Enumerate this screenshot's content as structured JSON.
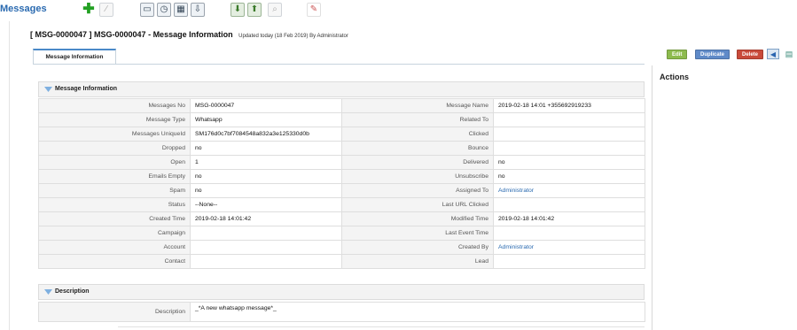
{
  "module_title": "Messages",
  "toolbar": {
    "buttons": [
      {
        "icon": "plus-icon"
      },
      {
        "icon": "blank-icon"
      },
      {
        "icon": "calendar-icon"
      },
      {
        "icon": "clock-icon"
      },
      {
        "icon": "calculator-icon"
      },
      {
        "icon": "import-icon"
      },
      {
        "icon": "download-icon"
      },
      {
        "icon": "upload-icon"
      },
      {
        "icon": "find-duplicates-icon"
      },
      {
        "icon": "settings-wrench-icon"
      }
    ]
  },
  "record": {
    "title": "[ MSG-0000047 ] MSG-0000047 - Message Information",
    "updated": "Updated today (18 Feb 2019) By Administrator"
  },
  "tab": {
    "label": "Message Information"
  },
  "actions": {
    "title": "Actions",
    "edit": "Edit",
    "duplicate": "Duplicate",
    "delete": "Delete"
  },
  "block_info": {
    "title": "Message Information",
    "rows": [
      {
        "l1": "Messages No",
        "v1": "MSG-0000047",
        "l2": "Message Name",
        "v2": "2019-02-18 14:01 +355692919233"
      },
      {
        "l1": "Message Type",
        "v1": "Whatsapp",
        "l2": "Related To",
        "v2": ""
      },
      {
        "l1": "Messages UniqueId",
        "v1": "SM176d0c7bf7084548a832a3e125330d0b",
        "l2": "Clicked",
        "v2": ""
      },
      {
        "l1": "Dropped",
        "v1": "no",
        "l2": "Bounce",
        "v2": ""
      },
      {
        "l1": "Open",
        "v1": "1",
        "l2": "Delivered",
        "v2": "no"
      },
      {
        "l1": "Emails Empty",
        "v1": "no",
        "l2": "Unsubscribe",
        "v2": "no"
      },
      {
        "l1": "Spam",
        "v1": "no",
        "l2": "Assigned To",
        "v2": "Administrator"
      },
      {
        "l1": "Status",
        "v1": "--None--",
        "l2": "Last URL Clicked",
        "v2": ""
      },
      {
        "l1": "Created Time",
        "v1": "2019-02-18 14:01:42",
        "l2": "Modified Time",
        "v2": "2019-02-18 14:01:42"
      },
      {
        "l1": "Campaign",
        "v1": "",
        "l2": "Last Event Time",
        "v2": ""
      },
      {
        "l1": "Account",
        "v1": "",
        "l2": "Created By",
        "v2": "Administrator"
      },
      {
        "l1": "Contact",
        "v1": "",
        "l2": "Lead",
        "v2": ""
      }
    ]
  },
  "block_desc": {
    "title": "Description",
    "label": "Description",
    "value": "_*A new whatsapp message*_"
  },
  "colors": {
    "link": "#2a6ab0",
    "edit": "#8dbb4e",
    "duplicate": "#5f8ac8",
    "delete": "#c94a3a"
  }
}
